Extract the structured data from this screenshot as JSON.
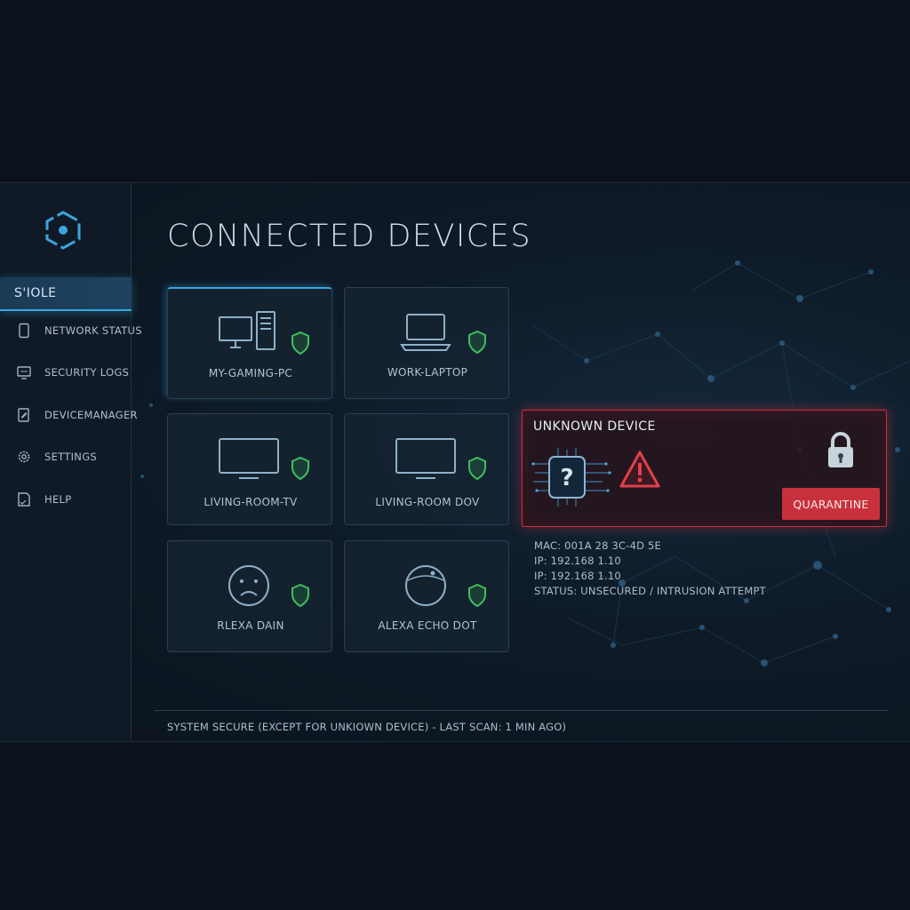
{
  "sidebar": {
    "active_item": "S'IOLE",
    "items": [
      {
        "label": "NETWORK STATUS",
        "icon": "tablet-icon"
      },
      {
        "label": "SECURITY LOGS",
        "icon": "monitor-icon"
      },
      {
        "label": "DEVICEMANAGER",
        "icon": "document-edit-icon"
      },
      {
        "label": "SETTINGS",
        "icon": "gear-icon"
      },
      {
        "label": "HELP",
        "icon": "help-page-icon"
      }
    ]
  },
  "page": {
    "title": "CONNECTED DEVICES"
  },
  "devices": [
    {
      "name": "MY-GAMING-PC",
      "icon": "desktop-pc-icon",
      "status_icon": "shield-check-icon"
    },
    {
      "name": "WORK-LAPTOP",
      "icon": "laptop-icon",
      "status_icon": "shield-check-icon"
    },
    {
      "name": "LIVING-ROOM-TV",
      "icon": "tv-icon",
      "status_icon": "shield-check-icon"
    },
    {
      "name": "LIVING-ROOM DOV",
      "icon": "tv-icon",
      "status_icon": "shield-check-icon"
    },
    {
      "name": "RLEXA DAIN",
      "icon": "sad-face-icon",
      "status_icon": "shield-check-icon"
    },
    {
      "name": "ALEXA ECHO DOT",
      "icon": "echo-dot-icon",
      "status_icon": "shield-check-icon"
    }
  ],
  "alert": {
    "title": "UNKNOWN DEVICE",
    "button_label": "QUARANTINE",
    "details": [
      "MAC: 001A 28 3C-4D 5E",
      "IP: 192.168 1.10",
      "IP: 192.168 1.10",
      "STATUS: UNSECURED / INTRUSION ATTEMPT"
    ]
  },
  "footer": {
    "status_text": "SYSTEM SECURE (EXCEPT FOR UNKIOWN DEVICE) - LAST SCAN: 1 MIN AGO)"
  },
  "colors": {
    "accent": "#3aa6e0",
    "secure": "#3fbf5a",
    "danger": "#c8313c",
    "background": "#0b121b"
  }
}
